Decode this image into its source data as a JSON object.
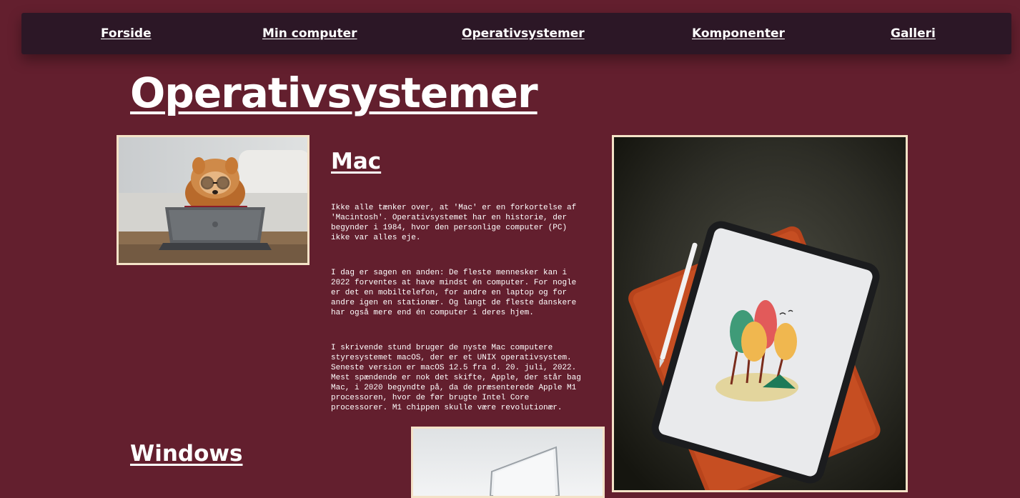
{
  "nav": {
    "items": [
      "Forside",
      "Min computer",
      "Operativsystemer",
      "Komponenter",
      "Galleri"
    ]
  },
  "page": {
    "title": "Operativsystemer"
  },
  "mac": {
    "heading": "Mac",
    "paragraphs": [
      "Ikke alle tænker over, at 'Mac' er en forkortelse af 'Macintosh'. Operativsystemet har en historie, der begynder i 1984, hvor den personlige computer (PC) ikke var alles eje.",
      "I dag er sagen en anden: De fleste mennesker kan i 2022 forventes at have mindst én computer. For nogle er det en mobiltelefon, for andre en laptop og for andre igen en stationær. Og langt de fleste danskere har også mere end én computer i deres hjem.",
      "I skrivende stund bruger de nyste Mac computere styresystemet macOS, der er et UNIX operativsystem. Seneste version er macOS 12.5 fra d. 20. juli, 2022. Mest spændende er nok det skifte, Apple, der står bag Mac, i 2020 begyndte på, da de præsenterede Apple M1 processoren, hvor de før brugte Intel Core processorer. M1 chippen skulle være revolutionær."
    ]
  },
  "windows": {
    "heading": "Windows"
  },
  "colors": {
    "background": "#631f2e",
    "navbar": "#2c1726",
    "photo_border": "#f4e2c7"
  }
}
